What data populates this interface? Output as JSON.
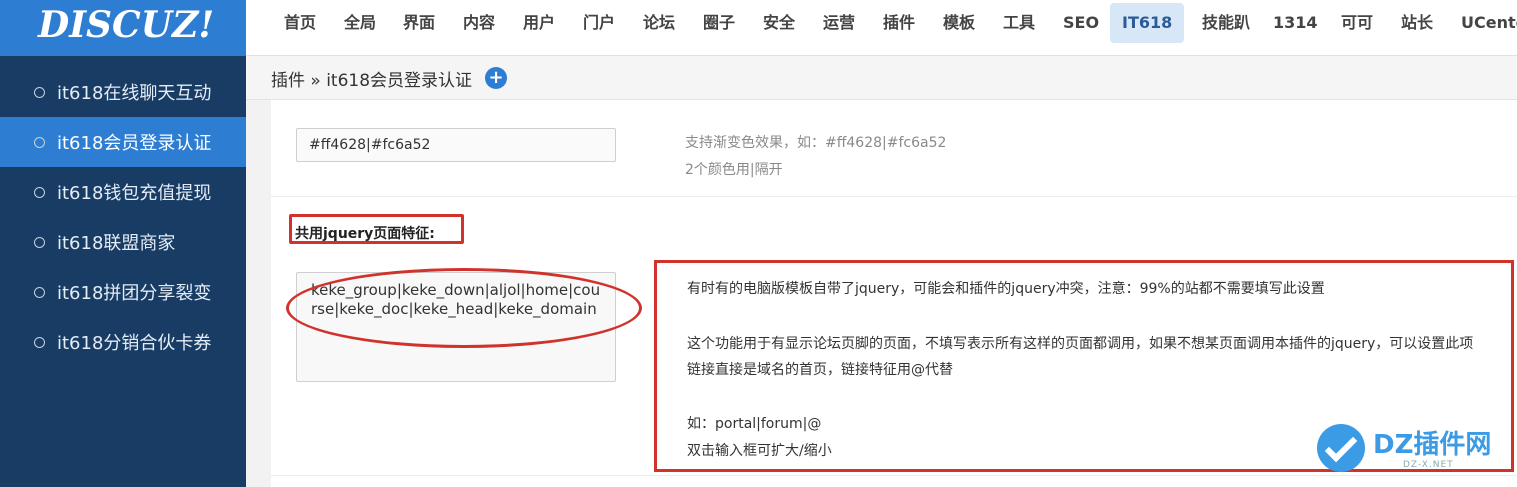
{
  "brand": {
    "logo_text": "DISCUZ!"
  },
  "sidebar": {
    "items": [
      {
        "label": "it618在线聊天互动",
        "active": false
      },
      {
        "label": "it618会员登录认证",
        "active": true
      },
      {
        "label": "it618钱包充值提现",
        "active": false
      },
      {
        "label": "it618联盟商家",
        "active": false
      },
      {
        "label": "it618拼团分享裂变",
        "active": false
      },
      {
        "label": "it618分销合伙卡券",
        "active": false
      }
    ]
  },
  "topnav": {
    "items": [
      {
        "label": "首页"
      },
      {
        "label": "全局"
      },
      {
        "label": "界面"
      },
      {
        "label": "内容"
      },
      {
        "label": "用户"
      },
      {
        "label": "门户"
      },
      {
        "label": "论坛"
      },
      {
        "label": "圈子"
      },
      {
        "label": "安全"
      },
      {
        "label": "运营"
      },
      {
        "label": "插件"
      },
      {
        "label": "模板"
      },
      {
        "label": "工具"
      },
      {
        "label": "SEO"
      },
      {
        "label": "IT618",
        "active": true
      },
      {
        "label": "技能趴"
      },
      {
        "label": "1314"
      },
      {
        "label": "可可"
      },
      {
        "label": "站长"
      },
      {
        "label": "UCenter"
      }
    ]
  },
  "breadcrumb": {
    "text": "插件 » it618会员登录认证",
    "add_icon": "plus-circle-icon"
  },
  "color_setting": {
    "value": "#ff4628|#fc6a52",
    "hint_line1": "支持渐变色效果，如：#ff4628|#fc6a52",
    "hint_line2": "2个颜色用|隔开"
  },
  "jquery_setting": {
    "label": "共用jquery页面特征:",
    "value": "keke_group|keke_down|aljol|home|course|keke_doc|keke_head|keke_domain",
    "help_lines": [
      "有时有的电脑版模板自带了jquery，可能会和插件的jquery冲突，注意：99%的站都不需要填写此设置",
      "这个功能用于有显示论坛页脚的页面，不填写表示所有这样的页面都调用，如果不想某页面调用本插件的jquery，可以设置此项",
      "链接直接是域名的首页，链接特征用@代替",
      "如：portal|forum|@",
      "双击输入框可扩大/缩小"
    ]
  },
  "watermark": {
    "text": "DZ插件网",
    "sub": "DZ-X.NET"
  },
  "colors": {
    "accent": "#2d7dd2",
    "sidebar_bg": "#183c64",
    "highlight_red": "#d0332c"
  }
}
